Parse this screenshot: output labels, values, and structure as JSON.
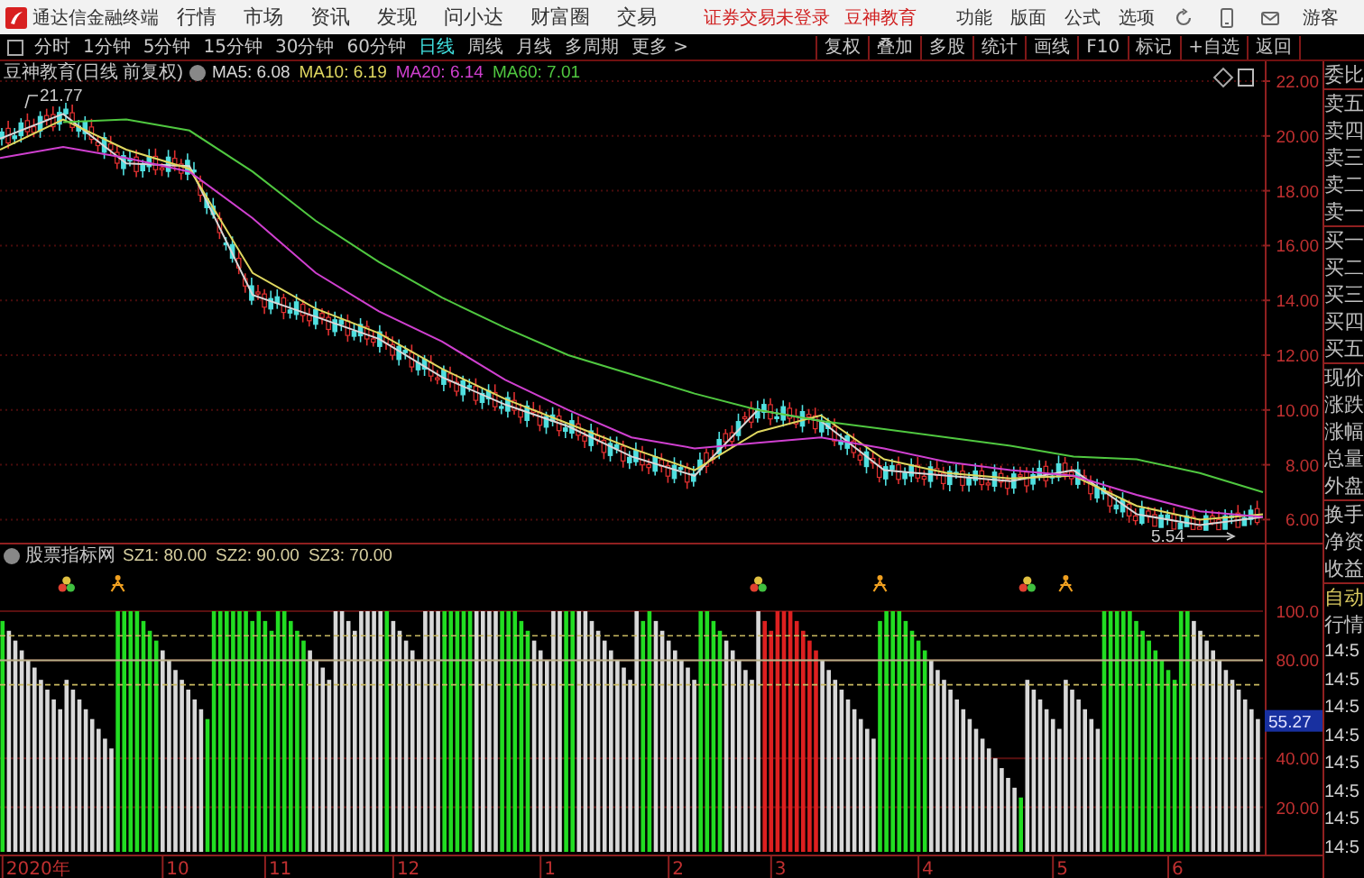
{
  "menubar": {
    "app_title": "通达信金融终端",
    "menus": [
      "行情",
      "市场",
      "资讯",
      "发现",
      "问小达",
      "财富圈",
      "交易"
    ],
    "notices": [
      "证券交易未登录",
      "豆神教育"
    ],
    "tools": [
      "功能",
      "版面",
      "公式",
      "选项"
    ],
    "user": "游客"
  },
  "toolbar": {
    "periods": [
      {
        "label": "分时",
        "selected": false
      },
      {
        "label": "1分钟",
        "selected": false
      },
      {
        "label": "5分钟",
        "selected": false
      },
      {
        "label": "15分钟",
        "selected": false
      },
      {
        "label": "30分钟",
        "selected": false
      },
      {
        "label": "60分钟",
        "selected": false
      },
      {
        "label": "日线",
        "selected": true
      },
      {
        "label": "周线",
        "selected": false
      },
      {
        "label": "月线",
        "selected": false
      },
      {
        "label": "多周期",
        "selected": false
      },
      {
        "label": "更多 >",
        "selected": false
      }
    ],
    "actions": [
      "复权",
      "叠加",
      "多股",
      "统计",
      "画线",
      "F10",
      "标记",
      "+自选",
      "返回"
    ]
  },
  "price_panel": {
    "title": "豆神教育(日线 前复权)",
    "legend": [
      {
        "label": "MA5: 6.08",
        "color": "#d8d8d8"
      },
      {
        "label": "MA10: 6.19",
        "color": "#e0d860"
      },
      {
        "label": "MA20: 6.14",
        "color": "#d040d0"
      },
      {
        "label": "MA60: 7.01",
        "color": "#50c840"
      }
    ],
    "axis_labels": [
      "22.00",
      "20.00",
      "18.00",
      "16.00",
      "14.00",
      "12.00",
      "10.00",
      "8.00",
      "6.00"
    ],
    "high_label": "21.77",
    "low_label": "5.54"
  },
  "indicator_panel": {
    "title": "股票指标网",
    "legend": [
      "SZ1: 80.00",
      "SZ2: 90.00",
      "SZ3: 70.00"
    ],
    "current_value": "55.27",
    "axis_labels": [
      "100.0",
      "80.00",
      "40.00",
      "20.00"
    ],
    "date_labels": [
      "2020年",
      "10",
      "11",
      "12",
      "1",
      "2",
      "3",
      "4",
      "5",
      "6"
    ]
  },
  "quote_sidebar": {
    "groups": [
      [
        "委比"
      ],
      [
        "卖五",
        "卖四",
        "卖三",
        "卖二",
        "卖一"
      ],
      [
        "买一",
        "买二",
        "买三",
        "买四",
        "买五"
      ],
      [
        "现价",
        "涨跌",
        "涨幅",
        "总量",
        "外盘"
      ],
      [
        "换手",
        "净资",
        "收益"
      ]
    ],
    "mode": "自动",
    "list_title": "行情",
    "times": [
      "14:5",
      "14:5",
      "14:5",
      "14:5",
      "14:5",
      "14:5",
      "14:5",
      "14:5"
    ]
  }
}
